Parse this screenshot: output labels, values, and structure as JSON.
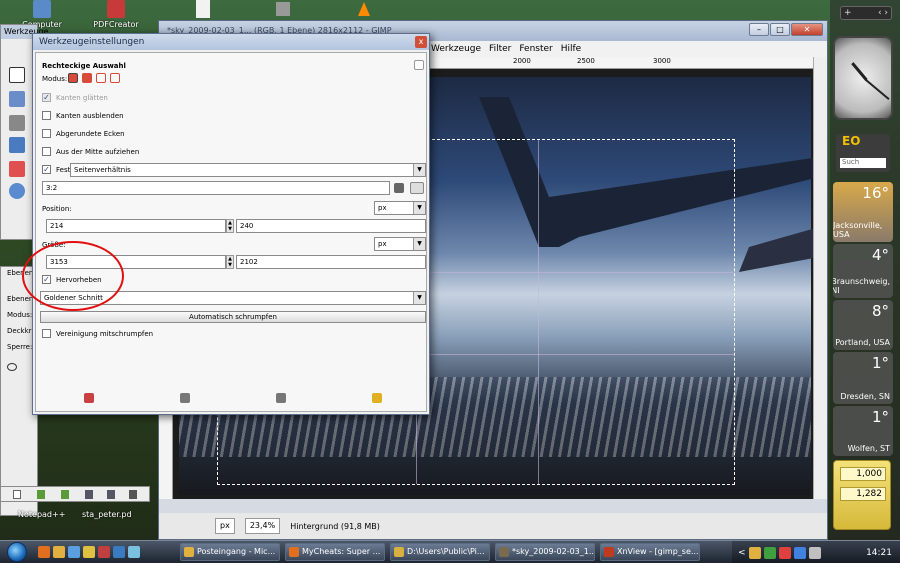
{
  "desktop": {
    "icons": [
      "Computer",
      "PDFCreator"
    ]
  },
  "gimp_image_window": {
    "title": "*sky_2009-02-03_1... (RGB, 1 Ebene) 2816x2112 - GIMP",
    "menu": [
      "Werkzeuge",
      "Filter",
      "Fenster",
      "Hilfe"
    ],
    "ruler_ticks": [
      "2000",
      "2500",
      "3000"
    ],
    "unit": "px",
    "zoom": "23,4%",
    "status": "Hintergrund (91,8 MB)"
  },
  "toolbox": {
    "title": "Werkzeuge"
  },
  "layers_panel": {
    "tab": "Ebenen",
    "labels": [
      "Ebenen",
      "Modus:",
      "Deckkraft:",
      "Sperre:"
    ]
  },
  "tool_options": {
    "title": "Werkzeugeinstellungen",
    "section": "Rechteckige Auswahl",
    "mode_label": "Modus:",
    "antialias": "Kanten glätten",
    "feather": "Kanten ausblenden",
    "rounded": "Abgerundete Ecken",
    "expand_center": "Aus der Mitte aufziehen",
    "fixed_label": "Fest:",
    "fixed_value": "Seitenverhältnis",
    "ratio_value": "3:2",
    "position_label": "Position:",
    "position_unit": "px",
    "position_x": "214",
    "position_y": "240",
    "size_label": "Größe:",
    "size_unit": "px",
    "size_w": "3153",
    "size_h": "2102",
    "highlight": "Hervorheben",
    "guides_value": "Goldener Schnitt",
    "autoshrink": "Automatisch schrumpfen",
    "shrink_merged": "Vereinigung mitschrumpfen"
  },
  "weather": [
    {
      "temp": "16°",
      "city": "Jacksonville, USA"
    },
    {
      "temp": "4°",
      "city": "Braunschweig, NI"
    },
    {
      "temp": "8°",
      "city": "Portland, USA"
    },
    {
      "temp": "1°",
      "city": "Dresden, SN"
    },
    {
      "temp": "1°",
      "city": "Wolfen, ST"
    }
  ],
  "currency": [
    "1,000",
    "1,282"
  ],
  "sidebar_search": "Such",
  "desktop_labels": [
    "Notepad++",
    "sta_peter.pd"
  ],
  "taskbar": {
    "tasks": [
      {
        "label": "Posteingang - Mic...",
        "color": "#e0b040"
      },
      {
        "label": "MyCheats: Super ...",
        "color": "#e07020"
      },
      {
        "label": "D:\\Users\\Public\\Pi...",
        "color": "#d8b040"
      },
      {
        "label": "*sky_2009-02-03_1...",
        "color": "#7a6a50"
      },
      {
        "label": "XnView - [gimp_se...",
        "color": "#c03a20"
      }
    ],
    "time": "14:21"
  }
}
